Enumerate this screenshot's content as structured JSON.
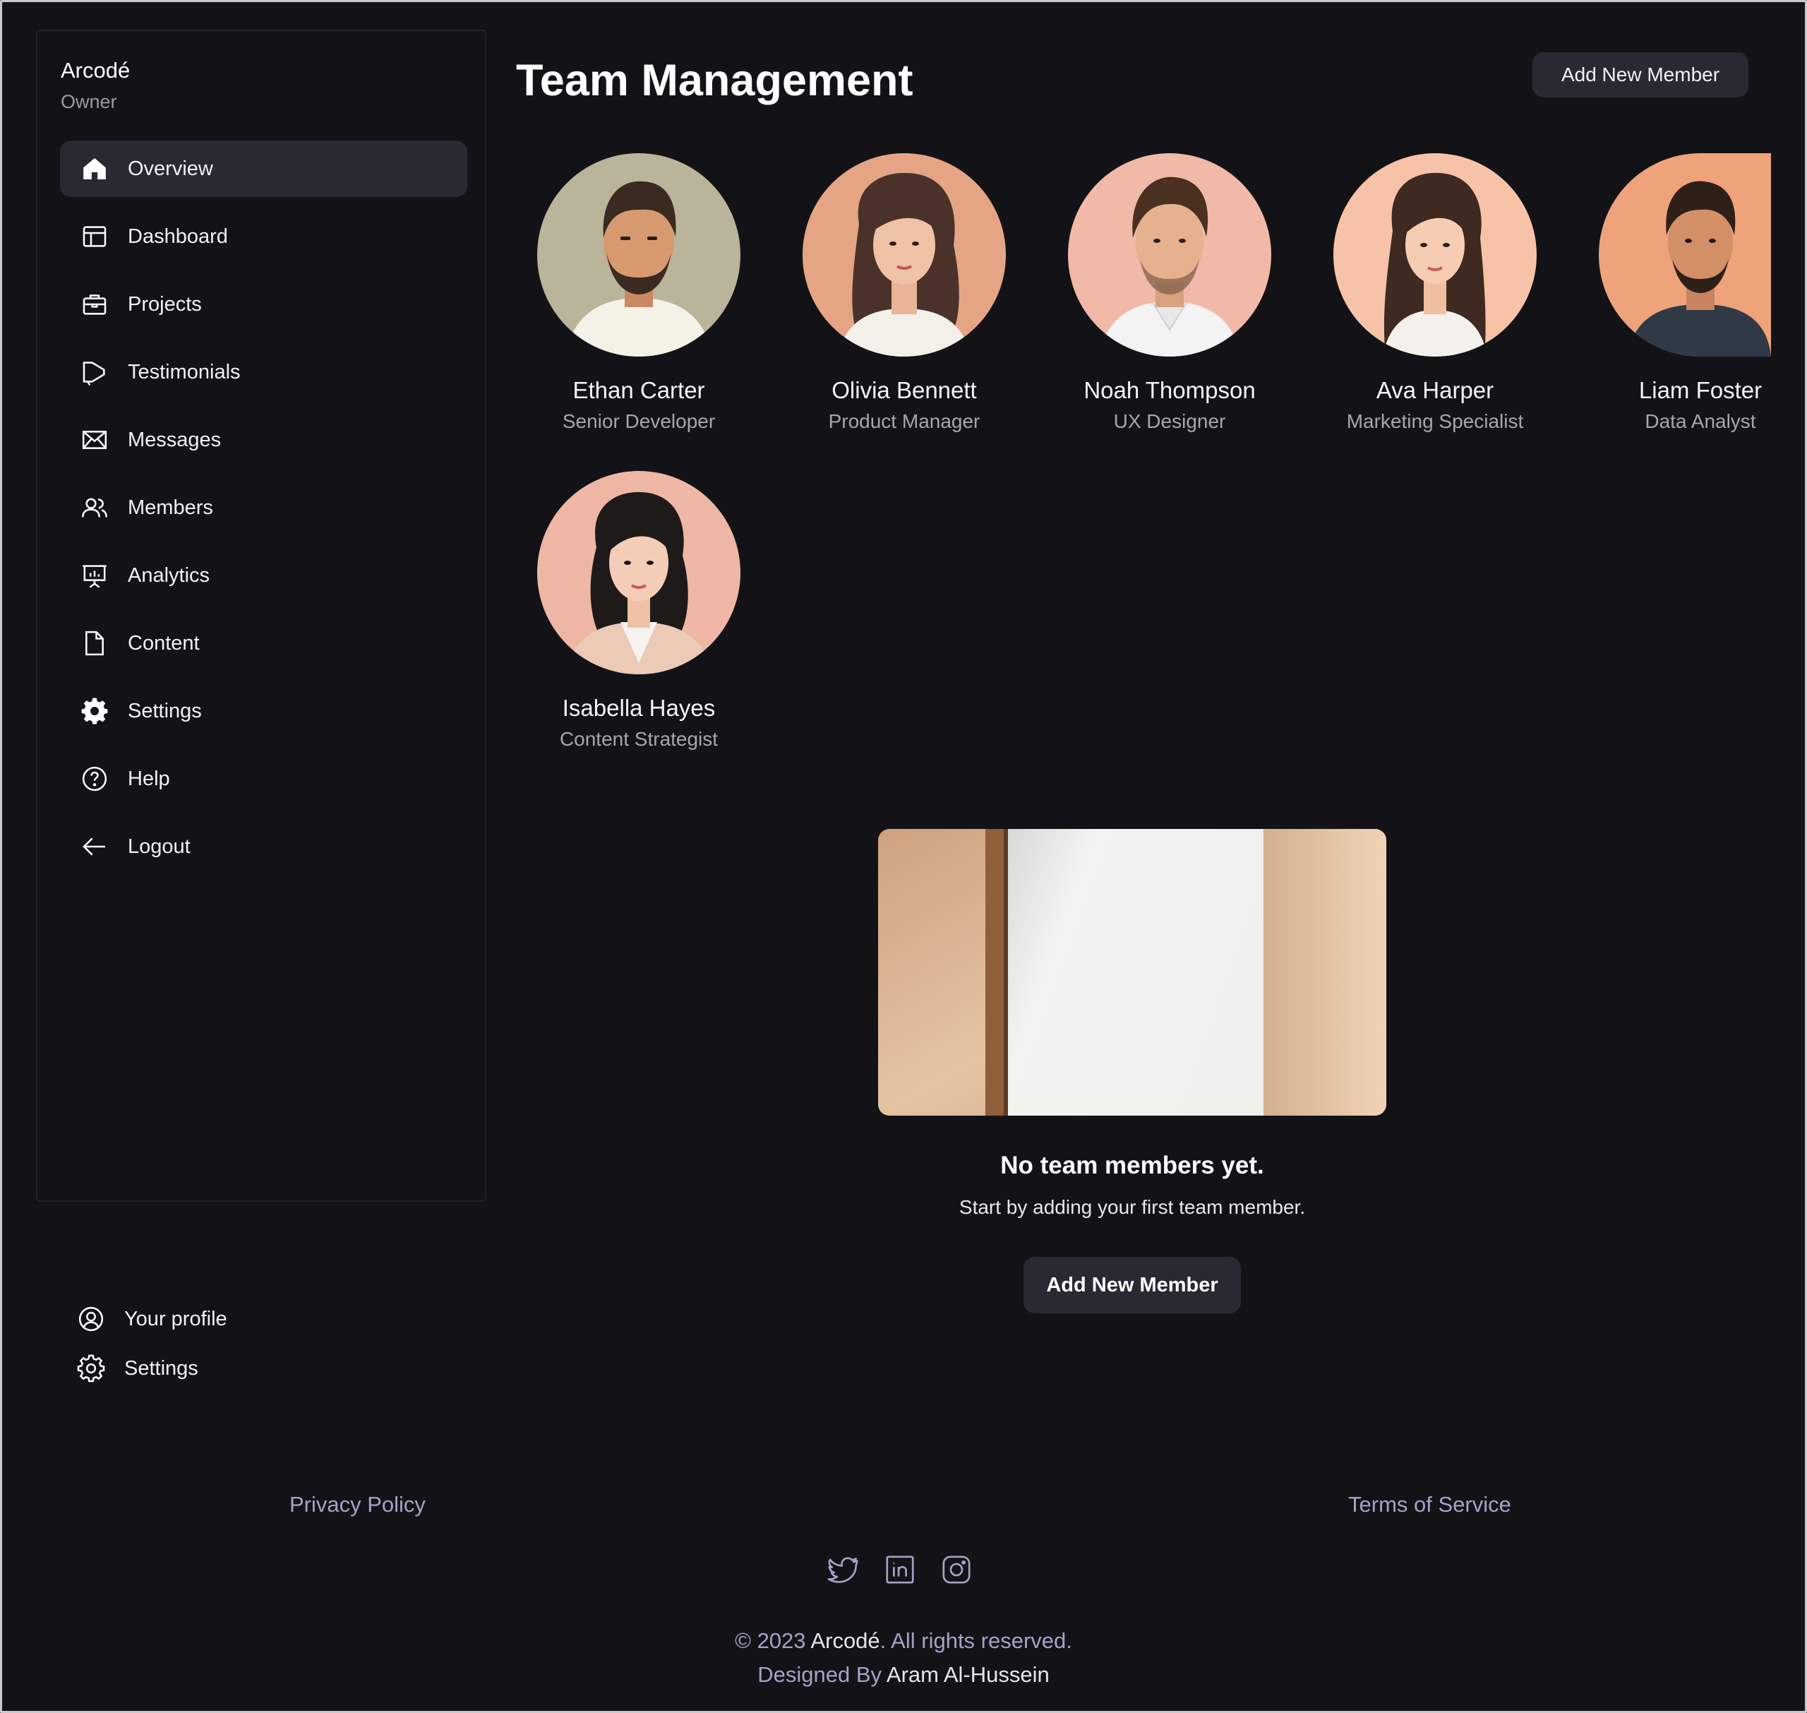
{
  "brand": {
    "name": "Arcodé",
    "role": "Owner"
  },
  "sidebar": {
    "items": [
      {
        "label": "Overview",
        "icon": "home-icon",
        "active": true
      },
      {
        "label": "Dashboard",
        "icon": "layout-icon"
      },
      {
        "label": "Projects",
        "icon": "briefcase-icon"
      },
      {
        "label": "Testimonials",
        "icon": "megaphone-icon"
      },
      {
        "label": "Messages",
        "icon": "mail-icon"
      },
      {
        "label": "Members",
        "icon": "users-icon"
      },
      {
        "label": "Analytics",
        "icon": "presentation-chart-icon"
      },
      {
        "label": "Content",
        "icon": "document-icon"
      },
      {
        "label": "Settings",
        "icon": "gear-solid-icon"
      },
      {
        "label": "Help",
        "icon": "question-circle-icon"
      },
      {
        "label": "Logout",
        "icon": "arrow-left-icon"
      }
    ],
    "bottom": [
      {
        "label": "Your profile",
        "icon": "user-circle-icon"
      },
      {
        "label": "Settings",
        "icon": "gear-icon"
      }
    ]
  },
  "header": {
    "title": "Team Management",
    "add_button": "Add New Member"
  },
  "members": [
    {
      "name": "Ethan Carter",
      "role": "Senior Developer"
    },
    {
      "name": "Olivia Bennett",
      "role": "Product Manager"
    },
    {
      "name": "Noah Thompson",
      "role": "UX Designer"
    },
    {
      "name": "Ava Harper",
      "role": "Marketing Specialist"
    },
    {
      "name": "Liam Foster",
      "role": "Data Analyst"
    },
    {
      "name": "Isabella Hayes",
      "role": "Content Strategist"
    }
  ],
  "empty_state": {
    "title": "No team members yet.",
    "subtitle": "Start by adding your first team member.",
    "button": "Add New Member"
  },
  "footer": {
    "privacy": "Privacy Policy",
    "terms": "Terms of Service",
    "social": [
      "twitter-icon",
      "linkedin-icon",
      "instagram-icon"
    ],
    "copyright_prefix": "© 2023 ",
    "copyright_brand": "Arcodé",
    "copyright_suffix": ". All rights reserved.",
    "designed_prefix": "Designed By ",
    "designed_name": "Aram Al-Hussein"
  },
  "colors": {
    "background": "#131317",
    "surface": "#2a2833",
    "muted_link": "#a9a0c7"
  }
}
